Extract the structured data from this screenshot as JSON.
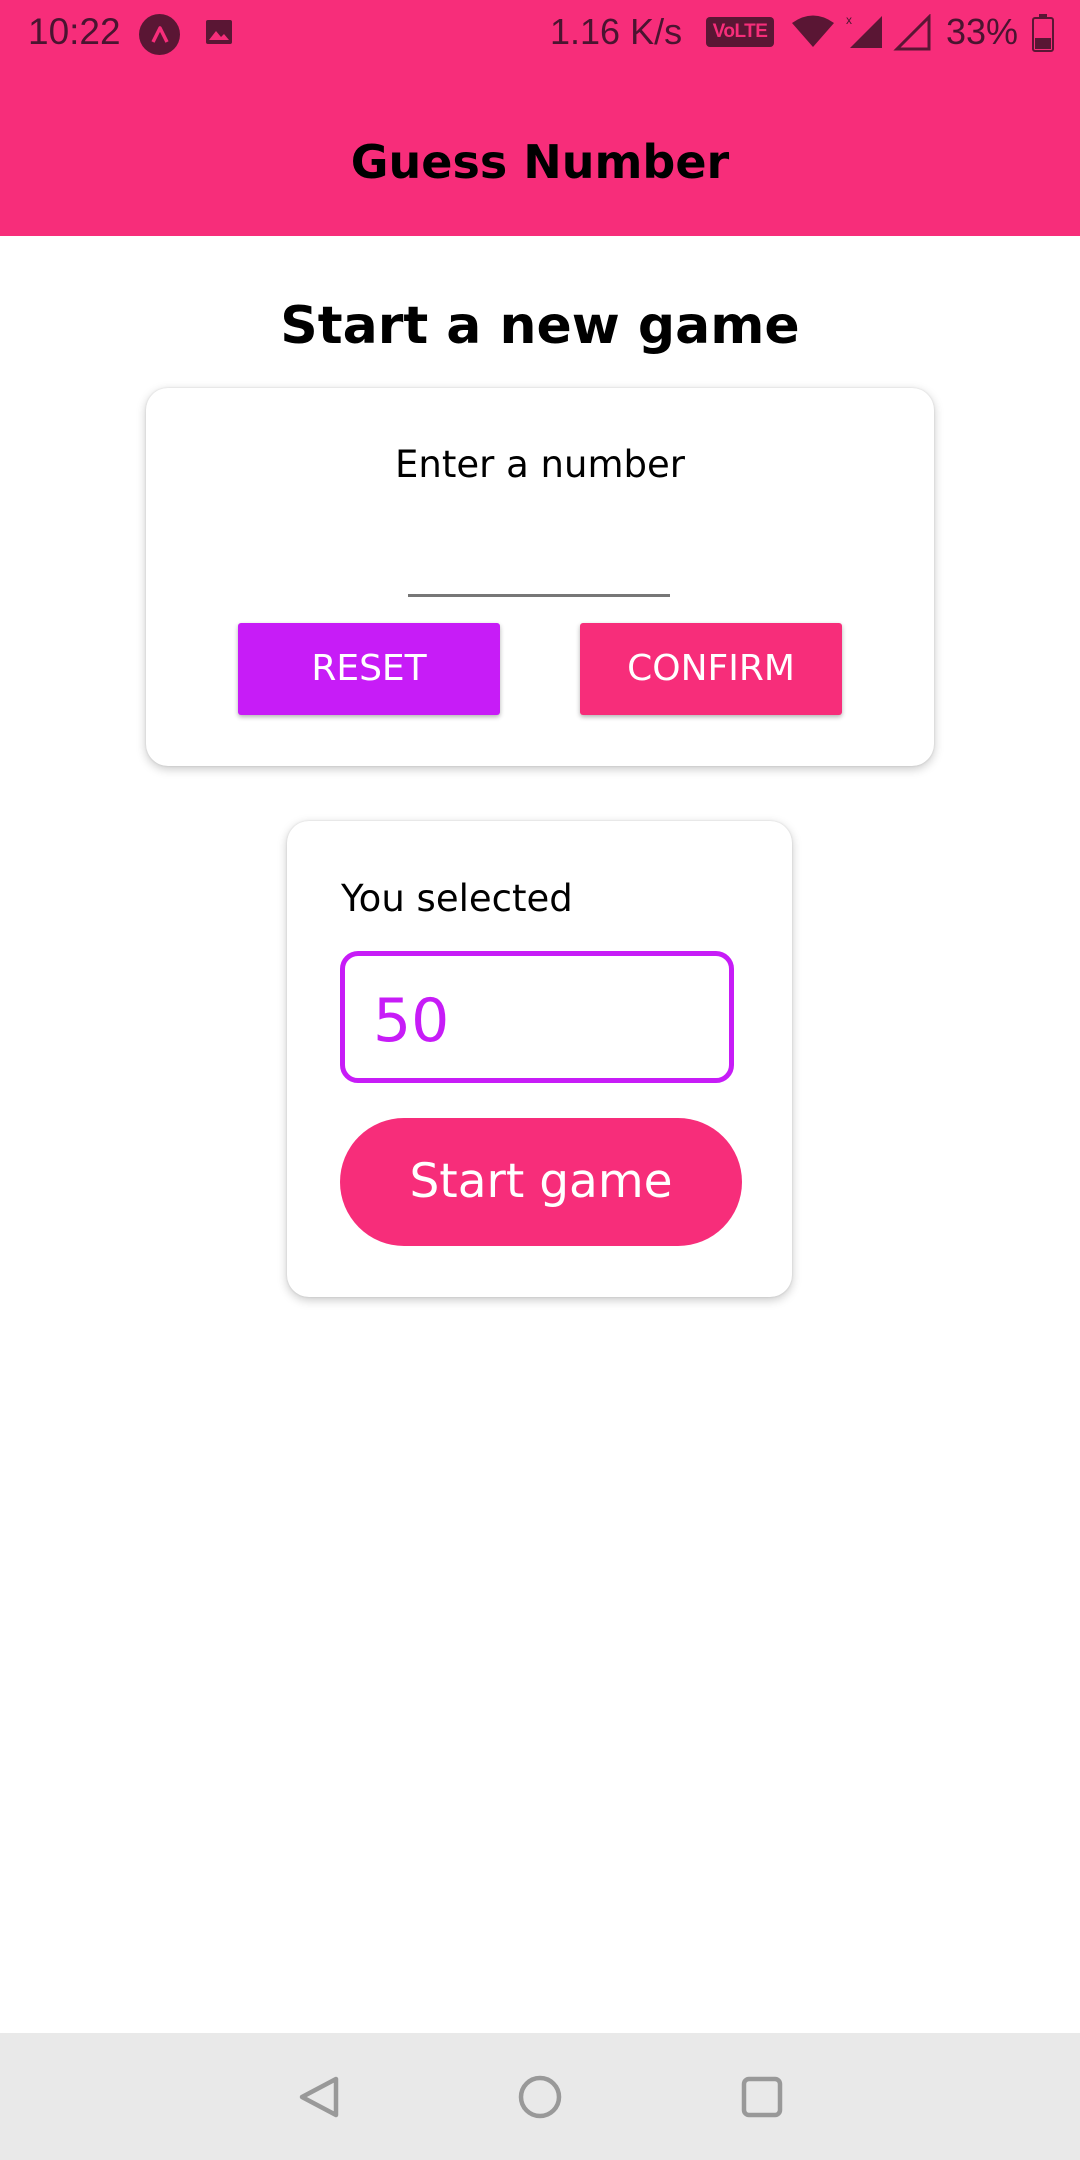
{
  "status_bar": {
    "time": "10:22",
    "net_speed": "1.16 K/s",
    "volte_label": "VoLTE",
    "battery": "33%",
    "icons": [
      "app-icon",
      "gallery-icon",
      "wifi-icon",
      "signal-icon",
      "signal-icon",
      "battery-icon"
    ]
  },
  "header": {
    "title": "Guess Number"
  },
  "main": {
    "heading": "Start a new game",
    "input_card": {
      "label": "Enter a number",
      "input_value": "",
      "reset_label": "RESET",
      "confirm_label": "CONFIRM"
    },
    "selected_card": {
      "label": "You selected",
      "number": "50",
      "start_label": "Start game"
    }
  },
  "nav_bar": {
    "icons": [
      "back-icon",
      "home-icon",
      "recents-icon"
    ]
  },
  "colors": {
    "primary": "#f72d7a",
    "accent": "#c71cf7",
    "nav_bg": "#e9e9e9"
  }
}
